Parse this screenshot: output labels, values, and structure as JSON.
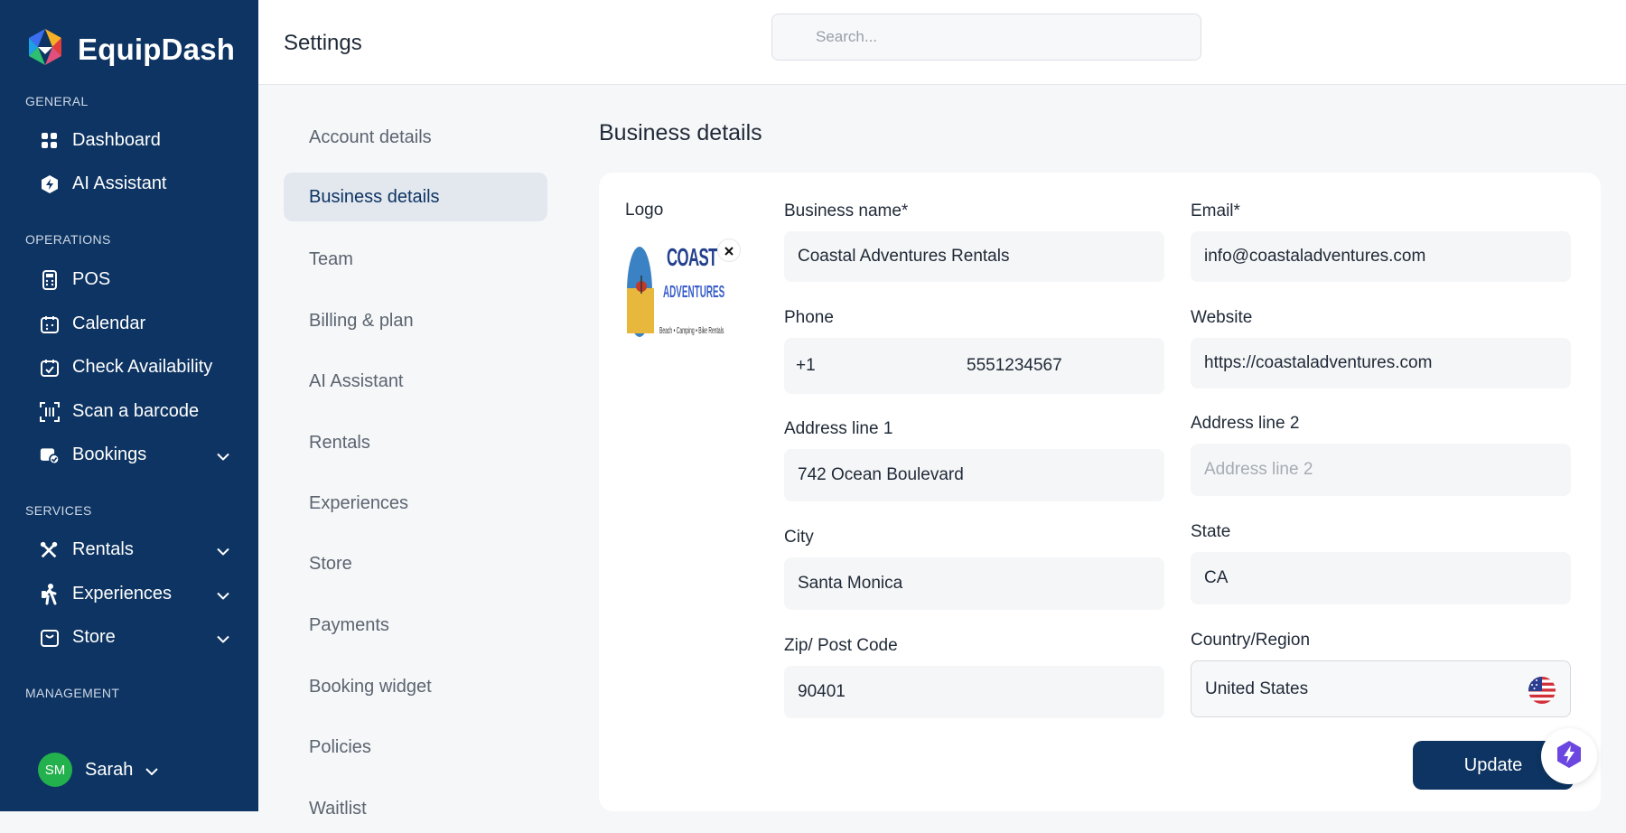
{
  "app": {
    "name": "EquipDash"
  },
  "sidebar": {
    "sections": {
      "general": "GENERAL",
      "operations": "OPERATIONS",
      "services": "SERVICES",
      "management": "MANAGEMENT"
    },
    "items": [
      {
        "label": "Dashboard",
        "icon": "dashboard-icon"
      },
      {
        "label": "AI Assistant",
        "icon": "ai-assistant-icon"
      },
      {
        "label": "POS",
        "icon": "pos-icon"
      },
      {
        "label": "Calendar",
        "icon": "calendar-icon"
      },
      {
        "label": "Check Availability",
        "icon": "check-availability-icon"
      },
      {
        "label": "Scan a barcode",
        "icon": "barcode-icon"
      },
      {
        "label": "Bookings",
        "icon": "bookings-icon"
      },
      {
        "label": "Rentals",
        "icon": "rentals-icon"
      },
      {
        "label": "Experiences",
        "icon": "experiences-icon"
      },
      {
        "label": "Store",
        "icon": "store-icon"
      }
    ],
    "user": {
      "initials": "SM",
      "name": "Sarah"
    }
  },
  "header": {
    "title": "Settings",
    "search_placeholder": "Search..."
  },
  "settings_nav": [
    {
      "label": "Account details"
    },
    {
      "label": "Business details",
      "active": true
    },
    {
      "label": "Team"
    },
    {
      "label": "Billing & plan"
    },
    {
      "label": "AI Assistant"
    },
    {
      "label": "Rentals"
    },
    {
      "label": "Experiences"
    },
    {
      "label": "Store"
    },
    {
      "label": "Payments"
    },
    {
      "label": "Booking widget"
    },
    {
      "label": "Policies"
    },
    {
      "label": "Waitlist"
    }
  ],
  "main": {
    "title": "Business details",
    "logo_label": "Logo",
    "logo": {
      "line1": "COAST",
      "line2": "ADVENTURES",
      "tagline": "Beach • Camping • Bike Rentals"
    },
    "fields": {
      "business_name": {
        "label": "Business name*",
        "value": "Coastal Adventures Rentals"
      },
      "email": {
        "label": "Email*",
        "value": "info@coastaladventures.com"
      },
      "phone": {
        "label": "Phone",
        "code": "+1",
        "value": "5551234567"
      },
      "website": {
        "label": "Website",
        "value": "https://coastaladventures.com"
      },
      "address1": {
        "label": "Address line 1",
        "value": "742 Ocean Boulevard"
      },
      "address2": {
        "label": "Address line 2",
        "placeholder": "Address line 2"
      },
      "city": {
        "label": "City",
        "value": "Santa Monica"
      },
      "state": {
        "label": "State",
        "value": "CA"
      },
      "zip": {
        "label": "Zip/ Post Code",
        "value": "90401"
      },
      "country": {
        "label": "Country/Region",
        "value": "United States",
        "flag_icon": "us-flag-icon"
      }
    },
    "update_label": "Update"
  }
}
